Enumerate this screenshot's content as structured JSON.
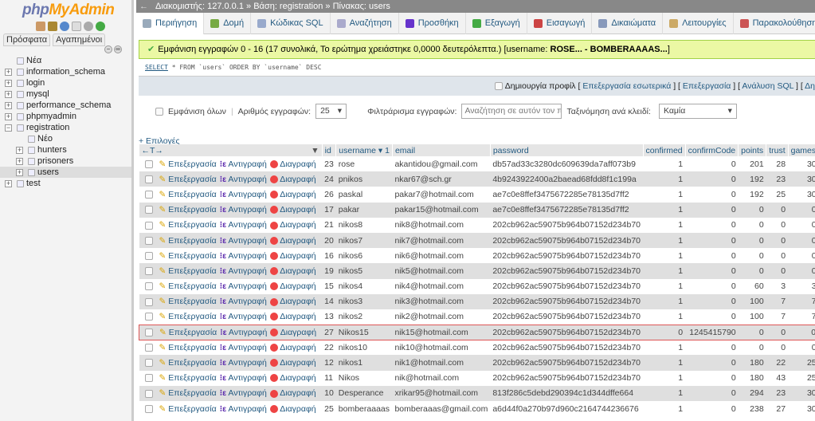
{
  "sidebar": {
    "logo_a": "php",
    "logo_b": "MyAdmin",
    "tabs": [
      "Πρόσφατα",
      "Αγαπημένοι"
    ],
    "tree": [
      {
        "label": "Νέα",
        "level": 0,
        "toggle": ""
      },
      {
        "label": "information_schema",
        "level": 0,
        "toggle": "+"
      },
      {
        "label": "login",
        "level": 0,
        "toggle": "+"
      },
      {
        "label": "mysql",
        "level": 0,
        "toggle": "+"
      },
      {
        "label": "performance_schema",
        "level": 0,
        "toggle": "+"
      },
      {
        "label": "phpmyadmin",
        "level": 0,
        "toggle": "+"
      },
      {
        "label": "registration",
        "level": 0,
        "toggle": "−"
      },
      {
        "label": "Νέο",
        "level": 1,
        "toggle": ""
      },
      {
        "label": "hunters",
        "level": 1,
        "toggle": "+"
      },
      {
        "label": "prisoners",
        "level": 1,
        "toggle": "+"
      },
      {
        "label": "users",
        "level": 1,
        "toggle": "+",
        "selected": true
      },
      {
        "label": "test",
        "level": 0,
        "toggle": "+"
      }
    ]
  },
  "breadcrumb": {
    "server": "Διακομιστής: 127.0.0.1",
    "db": "Βάση: registration",
    "table": "Πίνακας: users",
    "sep": "»"
  },
  "tabs": [
    {
      "label": "Περιήγηση",
      "active": true,
      "color": "#9ab"
    },
    {
      "label": "Δομή",
      "color": "#7a4"
    },
    {
      "label": "Κώδικας SQL",
      "color": "#9ac"
    },
    {
      "label": "Αναζήτηση",
      "color": "#aac"
    },
    {
      "label": "Προσθήκη",
      "color": "#63c"
    },
    {
      "label": "Εξαγωγή",
      "color": "#4a4"
    },
    {
      "label": "Εισαγωγή",
      "color": "#c44"
    },
    {
      "label": "Δικαιώματα",
      "color": "#89b"
    },
    {
      "label": "Λειτουργίες",
      "color": "#ca6"
    },
    {
      "label": "Παρακολούθηση",
      "color": "#c55"
    }
  ],
  "message": {
    "text": "Εμφάνιση εγγραφών 0 - 16 (17 συνολικά, Το ερώτημα χρειάστηκε 0,0000 δευτερόλεπτα.) [username: ",
    "bold": "ROSE... - BOMBERAAAAS...",
    "end": "]"
  },
  "sql": {
    "select": "SELECT",
    "rest": " * FROM `users` ORDER BY `username` DESC"
  },
  "options": {
    "profile": "Δημιουργία προφίλ",
    "links": [
      "Επεξεργασία εσωτερικά",
      "Επεξεργασία",
      "Ανάλυση SQL",
      "Δη"
    ]
  },
  "controls": {
    "show_all": "Εμφάνιση όλων",
    "rows_label": "Αριθμός εγγραφών:",
    "rows_value": "25",
    "filter_label": "Φιλτράρισμα εγγραφών:",
    "filter_placeholder": "Αναζήτηση σε αυτόν τον πίνακα",
    "sort_label": "Ταξινόμηση ανά κλειδί:",
    "sort_value": "Καμία"
  },
  "epiloges": "+ Επιλογές",
  "table": {
    "arrows": "←T→",
    "sort_marker": "▼",
    "columns": [
      "id",
      "username ▾ 1",
      "email",
      "password",
      "confirmed",
      "confirmCode",
      "points",
      "trust",
      "games"
    ],
    "actions": {
      "edit": "Επεξεργασία",
      "copy": "Αντιγραφή",
      "delete": "Διαγραφή"
    },
    "rows": [
      [
        "23",
        "rose",
        "akantidou@gmail.com",
        "db57ad33c3280dc609639da7aff073b9",
        "1",
        "0",
        "201",
        "28",
        "30"
      ],
      [
        "24",
        "pnikos",
        "nkar67@sch.gr",
        "4b9243922400a2baead68fdd8f1c199a",
        "1",
        "0",
        "192",
        "23",
        "30"
      ],
      [
        "26",
        "paskal",
        "pakar7@hotmail.com",
        "ae7c0e8ffef3475672285e78135d7ff2",
        "1",
        "0",
        "192",
        "25",
        "30"
      ],
      [
        "17",
        "pakar",
        "pakar15@hotmail.com",
        "ae7c0e8ffef3475672285e78135d7ff2",
        "1",
        "0",
        "0",
        "0",
        "0"
      ],
      [
        "21",
        "nikos8",
        "nik8@hotmail.com",
        "202cb962ac59075b964b07152d234b70",
        "1",
        "0",
        "0",
        "0",
        "0"
      ],
      [
        "20",
        "nikos7",
        "nik7@hotmail.com",
        "202cb962ac59075b964b07152d234b70",
        "1",
        "0",
        "0",
        "0",
        "0"
      ],
      [
        "16",
        "nikos6",
        "nik6@hotmail.com",
        "202cb962ac59075b964b07152d234b70",
        "1",
        "0",
        "0",
        "0",
        "0"
      ],
      [
        "19",
        "nikos5",
        "nik5@hotmail.com",
        "202cb962ac59075b964b07152d234b70",
        "1",
        "0",
        "0",
        "0",
        "0"
      ],
      [
        "15",
        "nikos4",
        "nik4@hotmail.com",
        "202cb962ac59075b964b07152d234b70",
        "1",
        "0",
        "60",
        "3",
        "3"
      ],
      [
        "14",
        "nikos3",
        "nik3@hotmail.com",
        "202cb962ac59075b964b07152d234b70",
        "1",
        "0",
        "100",
        "7",
        "7"
      ],
      [
        "13",
        "nikos2",
        "nik2@hotmail.com",
        "202cb962ac59075b964b07152d234b70",
        "1",
        "0",
        "100",
        "7",
        "7"
      ],
      [
        "27",
        "Nikos15",
        "nik15@hotmail.com",
        "202cb962ac59075b964b07152d234b70",
        "0",
        "1245415790",
        "0",
        "0",
        "0"
      ],
      [
        "22",
        "nikos10",
        "nik10@hotmail.com",
        "202cb962ac59075b964b07152d234b70",
        "1",
        "0",
        "0",
        "0",
        "0"
      ],
      [
        "12",
        "nikos1",
        "nik1@hotmail.com",
        "202cb962ac59075b964b07152d234b70",
        "1",
        "0",
        "180",
        "22",
        "25"
      ],
      [
        "11",
        "Nikos",
        "nik@hotmail.com",
        "202cb962ac59075b964b07152d234b70",
        "1",
        "0",
        "180",
        "43",
        "25"
      ],
      [
        "10",
        "Desperance",
        "xrikar95@hotmail.com",
        "813f286c5debd290394c1d344dffe664",
        "1",
        "0",
        "294",
        "23",
        "30"
      ],
      [
        "25",
        "bomberaaaas",
        "bomberaaas@gmail.com",
        "a6d44f0a270b97d960c2164744236676",
        "1",
        "0",
        "238",
        "27",
        "30"
      ]
    ],
    "highlighted_row": 11
  }
}
